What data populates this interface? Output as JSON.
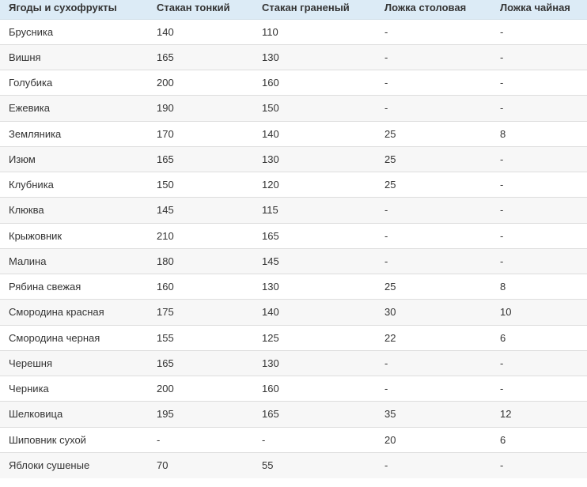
{
  "table": {
    "headers": [
      "Ягоды и сухофрукты",
      "Стакан тонкий",
      "Стакан граненый",
      "Ложка столовая",
      "Ложка чайная"
    ],
    "rows": [
      [
        "Брусника",
        "140",
        "110",
        "-",
        "-"
      ],
      [
        "Вишня",
        "165",
        "130",
        "-",
        "-"
      ],
      [
        "Голубика",
        "200",
        "160",
        "-",
        "-"
      ],
      [
        "Ежевика",
        "190",
        "150",
        "-",
        "-"
      ],
      [
        "Земляника",
        "170",
        "140",
        "25",
        "8"
      ],
      [
        "Изюм",
        "165",
        "130",
        "25",
        "-"
      ],
      [
        "Клубника",
        "150",
        "120",
        "25",
        "-"
      ],
      [
        "Клюква",
        "145",
        "115",
        "-",
        "-"
      ],
      [
        "Крыжовник",
        "210",
        "165",
        "-",
        "-"
      ],
      [
        "Малина",
        "180",
        "145",
        "-",
        "-"
      ],
      [
        "Рябина свежая",
        "160",
        "130",
        "25",
        "8"
      ],
      [
        "Смородина красная",
        "175",
        "140",
        "30",
        "10"
      ],
      [
        "Смородина черная",
        "155",
        "125",
        "22",
        "6"
      ],
      [
        "Черешня",
        "165",
        "130",
        "-",
        "-"
      ],
      [
        "Черника",
        "200",
        "160",
        "-",
        "-"
      ],
      [
        "Шелковица",
        "195",
        "165",
        "35",
        "12"
      ],
      [
        "Шиповник сухой",
        "-",
        "-",
        "20",
        "6"
      ],
      [
        "Яблоки сушеные",
        "70",
        "55",
        "-",
        "-"
      ]
    ]
  },
  "colors": {
    "header_bg": "#dcebf6",
    "row_stripe": "#f7f7f7",
    "border": "#dddddd",
    "text": "#333333"
  }
}
